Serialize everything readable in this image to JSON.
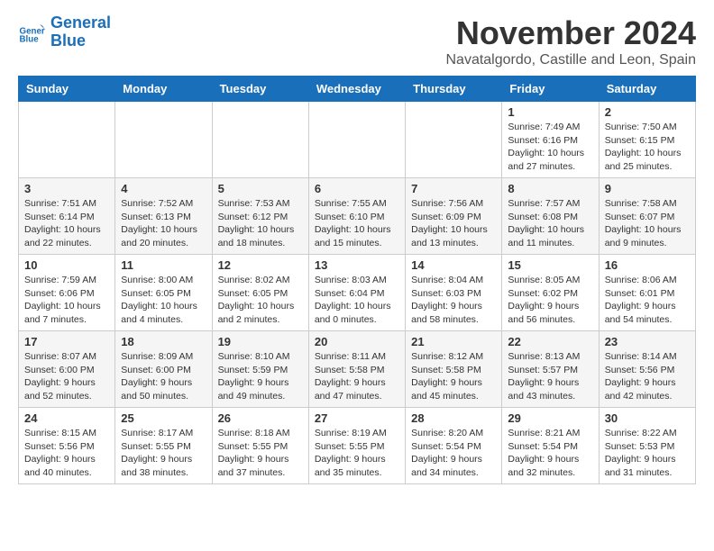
{
  "header": {
    "logo_line1": "General",
    "logo_line2": "Blue",
    "month": "November 2024",
    "location": "Navatalgordo, Castille and Leon, Spain"
  },
  "weekdays": [
    "Sunday",
    "Monday",
    "Tuesday",
    "Wednesday",
    "Thursday",
    "Friday",
    "Saturday"
  ],
  "weeks": [
    [
      {
        "day": "",
        "info": ""
      },
      {
        "day": "",
        "info": ""
      },
      {
        "day": "",
        "info": ""
      },
      {
        "day": "",
        "info": ""
      },
      {
        "day": "",
        "info": ""
      },
      {
        "day": "1",
        "info": "Sunrise: 7:49 AM\nSunset: 6:16 PM\nDaylight: 10 hours and 27 minutes."
      },
      {
        "day": "2",
        "info": "Sunrise: 7:50 AM\nSunset: 6:15 PM\nDaylight: 10 hours and 25 minutes."
      }
    ],
    [
      {
        "day": "3",
        "info": "Sunrise: 7:51 AM\nSunset: 6:14 PM\nDaylight: 10 hours and 22 minutes."
      },
      {
        "day": "4",
        "info": "Sunrise: 7:52 AM\nSunset: 6:13 PM\nDaylight: 10 hours and 20 minutes."
      },
      {
        "day": "5",
        "info": "Sunrise: 7:53 AM\nSunset: 6:12 PM\nDaylight: 10 hours and 18 minutes."
      },
      {
        "day": "6",
        "info": "Sunrise: 7:55 AM\nSunset: 6:10 PM\nDaylight: 10 hours and 15 minutes."
      },
      {
        "day": "7",
        "info": "Sunrise: 7:56 AM\nSunset: 6:09 PM\nDaylight: 10 hours and 13 minutes."
      },
      {
        "day": "8",
        "info": "Sunrise: 7:57 AM\nSunset: 6:08 PM\nDaylight: 10 hours and 11 minutes."
      },
      {
        "day": "9",
        "info": "Sunrise: 7:58 AM\nSunset: 6:07 PM\nDaylight: 10 hours and 9 minutes."
      }
    ],
    [
      {
        "day": "10",
        "info": "Sunrise: 7:59 AM\nSunset: 6:06 PM\nDaylight: 10 hours and 7 minutes."
      },
      {
        "day": "11",
        "info": "Sunrise: 8:00 AM\nSunset: 6:05 PM\nDaylight: 10 hours and 4 minutes."
      },
      {
        "day": "12",
        "info": "Sunrise: 8:02 AM\nSunset: 6:05 PM\nDaylight: 10 hours and 2 minutes."
      },
      {
        "day": "13",
        "info": "Sunrise: 8:03 AM\nSunset: 6:04 PM\nDaylight: 10 hours and 0 minutes."
      },
      {
        "day": "14",
        "info": "Sunrise: 8:04 AM\nSunset: 6:03 PM\nDaylight: 9 hours and 58 minutes."
      },
      {
        "day": "15",
        "info": "Sunrise: 8:05 AM\nSunset: 6:02 PM\nDaylight: 9 hours and 56 minutes."
      },
      {
        "day": "16",
        "info": "Sunrise: 8:06 AM\nSunset: 6:01 PM\nDaylight: 9 hours and 54 minutes."
      }
    ],
    [
      {
        "day": "17",
        "info": "Sunrise: 8:07 AM\nSunset: 6:00 PM\nDaylight: 9 hours and 52 minutes."
      },
      {
        "day": "18",
        "info": "Sunrise: 8:09 AM\nSunset: 6:00 PM\nDaylight: 9 hours and 50 minutes."
      },
      {
        "day": "19",
        "info": "Sunrise: 8:10 AM\nSunset: 5:59 PM\nDaylight: 9 hours and 49 minutes."
      },
      {
        "day": "20",
        "info": "Sunrise: 8:11 AM\nSunset: 5:58 PM\nDaylight: 9 hours and 47 minutes."
      },
      {
        "day": "21",
        "info": "Sunrise: 8:12 AM\nSunset: 5:58 PM\nDaylight: 9 hours and 45 minutes."
      },
      {
        "day": "22",
        "info": "Sunrise: 8:13 AM\nSunset: 5:57 PM\nDaylight: 9 hours and 43 minutes."
      },
      {
        "day": "23",
        "info": "Sunrise: 8:14 AM\nSunset: 5:56 PM\nDaylight: 9 hours and 42 minutes."
      }
    ],
    [
      {
        "day": "24",
        "info": "Sunrise: 8:15 AM\nSunset: 5:56 PM\nDaylight: 9 hours and 40 minutes."
      },
      {
        "day": "25",
        "info": "Sunrise: 8:17 AM\nSunset: 5:55 PM\nDaylight: 9 hours and 38 minutes."
      },
      {
        "day": "26",
        "info": "Sunrise: 8:18 AM\nSunset: 5:55 PM\nDaylight: 9 hours and 37 minutes."
      },
      {
        "day": "27",
        "info": "Sunrise: 8:19 AM\nSunset: 5:55 PM\nDaylight: 9 hours and 35 minutes."
      },
      {
        "day": "28",
        "info": "Sunrise: 8:20 AM\nSunset: 5:54 PM\nDaylight: 9 hours and 34 minutes."
      },
      {
        "day": "29",
        "info": "Sunrise: 8:21 AM\nSunset: 5:54 PM\nDaylight: 9 hours and 32 minutes."
      },
      {
        "day": "30",
        "info": "Sunrise: 8:22 AM\nSunset: 5:53 PM\nDaylight: 9 hours and 31 minutes."
      }
    ]
  ]
}
